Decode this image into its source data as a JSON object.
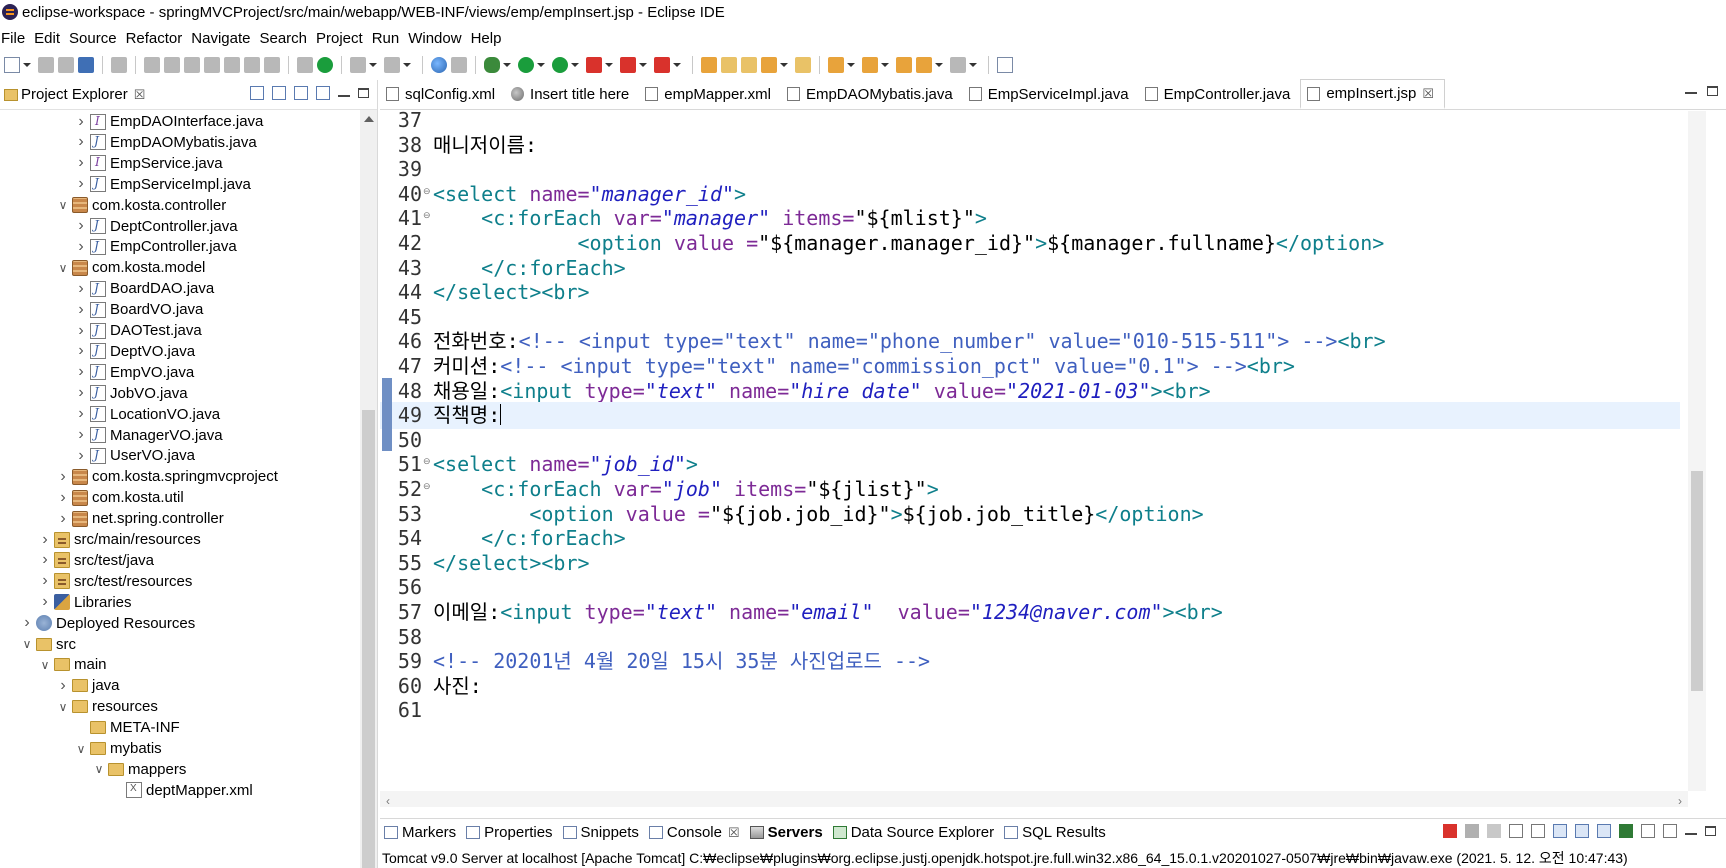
{
  "window": {
    "title": "eclipse-workspace - springMVCProject/src/main/webapp/WEB-INF/views/emp/empInsert.jsp - Eclipse IDE"
  },
  "menu": [
    "File",
    "Edit",
    "Source",
    "Refactor",
    "Navigate",
    "Search",
    "Project",
    "Run",
    "Window",
    "Help"
  ],
  "project_explorer": {
    "title": "Project Explorer",
    "close": "☒",
    "items": [
      {
        "label": "EmpDAOInterface.java",
        "icon": "interface-icon",
        "indent": 4,
        "twisty": "closed"
      },
      {
        "label": "EmpDAOMybatis.java",
        "icon": "java-file-icon",
        "indent": 4,
        "twisty": "closed"
      },
      {
        "label": "EmpService.java",
        "icon": "interface-icon",
        "indent": 4,
        "twisty": "closed"
      },
      {
        "label": "EmpServiceImpl.java",
        "icon": "java-file-icon",
        "indent": 4,
        "twisty": "closed"
      },
      {
        "label": "com.kosta.controller",
        "icon": "package-icon",
        "indent": 3,
        "twisty": "open"
      },
      {
        "label": "DeptController.java",
        "icon": "java-file-icon",
        "indent": 4,
        "twisty": "closed"
      },
      {
        "label": "EmpController.java",
        "icon": "java-file-icon",
        "indent": 4,
        "twisty": "closed"
      },
      {
        "label": "com.kosta.model",
        "icon": "package-icon",
        "indent": 3,
        "twisty": "open"
      },
      {
        "label": "BoardDAO.java",
        "icon": "java-file-icon",
        "indent": 4,
        "twisty": "closed"
      },
      {
        "label": "BoardVO.java",
        "icon": "java-file-icon",
        "indent": 4,
        "twisty": "closed"
      },
      {
        "label": "DAOTest.java",
        "icon": "java-file-icon",
        "indent": 4,
        "twisty": "closed"
      },
      {
        "label": "DeptVO.java",
        "icon": "java-file-icon",
        "indent": 4,
        "twisty": "closed"
      },
      {
        "label": "EmpVO.java",
        "icon": "java-file-icon",
        "indent": 4,
        "twisty": "closed"
      },
      {
        "label": "JobVO.java",
        "icon": "java-file-icon",
        "indent": 4,
        "twisty": "closed"
      },
      {
        "label": "LocationVO.java",
        "icon": "java-file-icon",
        "indent": 4,
        "twisty": "closed"
      },
      {
        "label": "ManagerVO.java",
        "icon": "java-file-icon",
        "indent": 4,
        "twisty": "closed"
      },
      {
        "label": "UserVO.java",
        "icon": "java-file-icon",
        "indent": 4,
        "twisty": "closed"
      },
      {
        "label": "com.kosta.springmvcproject",
        "icon": "package-icon",
        "indent": 3,
        "twisty": "closed"
      },
      {
        "label": "com.kosta.util",
        "icon": "package-icon",
        "indent": 3,
        "twisty": "closed"
      },
      {
        "label": "net.spring.controller",
        "icon": "package-icon",
        "indent": 3,
        "twisty": "closed"
      },
      {
        "label": "src/main/resources",
        "icon": "source-folder-icon",
        "indent": 2,
        "twisty": "closed"
      },
      {
        "label": "src/test/java",
        "icon": "source-folder-icon",
        "indent": 2,
        "twisty": "closed"
      },
      {
        "label": "src/test/resources",
        "icon": "source-folder-icon",
        "indent": 2,
        "twisty": "closed"
      },
      {
        "label": "Libraries",
        "icon": "libraries-icon",
        "indent": 2,
        "twisty": "closed"
      },
      {
        "label": "Deployed Resources",
        "icon": "deployed-resources-icon",
        "indent": 1,
        "twisty": "closed"
      },
      {
        "label": "src",
        "icon": "folder-icon",
        "indent": 1,
        "twisty": "open"
      },
      {
        "label": "main",
        "icon": "folder-icon",
        "indent": 2,
        "twisty": "open"
      },
      {
        "label": "java",
        "icon": "folder-icon",
        "indent": 3,
        "twisty": "closed"
      },
      {
        "label": "resources",
        "icon": "folder-icon",
        "indent": 3,
        "twisty": "open"
      },
      {
        "label": "META-INF",
        "icon": "folder-icon",
        "indent": 4,
        "twisty": "none"
      },
      {
        "label": "mybatis",
        "icon": "folder-icon",
        "indent": 4,
        "twisty": "open"
      },
      {
        "label": "mappers",
        "icon": "folder-icon",
        "indent": 5,
        "twisty": "open"
      },
      {
        "label": "deptMapper.xml",
        "icon": "xml-file-icon",
        "indent": 6,
        "twisty": "none"
      }
    ]
  },
  "editor_tabs": [
    {
      "label": "sqlConfig.xml",
      "icon": "xml-file-icon",
      "active": false
    },
    {
      "label": "Insert title here",
      "icon": "browser-icon",
      "active": false
    },
    {
      "label": "empMapper.xml",
      "icon": "xml-file-icon",
      "active": false
    },
    {
      "label": "EmpDAOMybatis.java",
      "icon": "java-file-icon",
      "active": false
    },
    {
      "label": "EmpServiceImpl.java",
      "icon": "java-file-icon",
      "active": false
    },
    {
      "label": "EmpController.java",
      "icon": "java-file-icon",
      "active": false
    },
    {
      "label": "empInsert.jsp",
      "icon": "jsp-file-icon",
      "active": true,
      "close": "☒"
    }
  ],
  "code_lines": [
    {
      "n": "37",
      "fold": "",
      "parts": []
    },
    {
      "n": "38",
      "fold": "",
      "parts": [
        {
          "t": "매니저이름:",
          "c": "c-el"
        }
      ]
    },
    {
      "n": "39",
      "fold": "",
      "parts": []
    },
    {
      "n": "40",
      "fold": "⊖",
      "parts": [
        {
          "t": "<select ",
          "c": "c-tag"
        },
        {
          "t": "name=",
          "c": "c-attr"
        },
        {
          "t": "\"manager_id\"",
          "c": "c-str"
        },
        {
          "t": ">",
          "c": "c-tag"
        }
      ]
    },
    {
      "n": "41",
      "fold": "⊖",
      "parts": [
        {
          "t": "    <c:forEach ",
          "c": "c-tag"
        },
        {
          "t": "var=",
          "c": "c-attr"
        },
        {
          "t": "\"manager\"",
          "c": "c-str"
        },
        {
          "t": " items=",
          "c": "c-attr"
        },
        {
          "t": "\"${mlist}\"",
          "c": "c-plain-str"
        },
        {
          "t": ">",
          "c": "c-tag"
        }
      ]
    },
    {
      "n": "42",
      "fold": "",
      "parts": [
        {
          "t": "            <option ",
          "c": "c-tag"
        },
        {
          "t": "value =",
          "c": "c-attr"
        },
        {
          "t": "\"${manager.manager_id}\"",
          "c": "c-plain-str"
        },
        {
          "t": ">",
          "c": "c-tag"
        },
        {
          "t": "${manager.fullname}",
          "c": "c-el"
        },
        {
          "t": "</option>",
          "c": "c-tag"
        }
      ]
    },
    {
      "n": "43",
      "fold": "",
      "parts": [
        {
          "t": "    </c:forEach>",
          "c": "c-tag"
        }
      ]
    },
    {
      "n": "44",
      "fold": "",
      "parts": [
        {
          "t": "</select><br>",
          "c": "c-tag"
        }
      ]
    },
    {
      "n": "45",
      "fold": "",
      "parts": []
    },
    {
      "n": "46",
      "fold": "",
      "parts": [
        {
          "t": "전화번호:",
          "c": "c-el"
        },
        {
          "t": "<!-- <input type=\"text\" name=\"phone_number\" value=\"010-515-511\"> -->",
          "c": "c-comment"
        },
        {
          "t": "<br>",
          "c": "c-tag"
        }
      ]
    },
    {
      "n": "47",
      "fold": "",
      "parts": [
        {
          "t": "커미션:",
          "c": "c-el"
        },
        {
          "t": "<!-- <input type=\"text\" name=\"commission_pct\" value=\"0.1\"> -->",
          "c": "c-comment"
        },
        {
          "t": "<br>",
          "c": "c-tag"
        }
      ]
    },
    {
      "n": "48",
      "fold": "",
      "parts": [
        {
          "t": "채용일:",
          "c": "c-el"
        },
        {
          "t": "<input ",
          "c": "c-tag"
        },
        {
          "t": "type=",
          "c": "c-attr"
        },
        {
          "t": "\"text\"",
          "c": "c-str"
        },
        {
          "t": " name=",
          "c": "c-attr"
        },
        {
          "t": "\"hire_date\"",
          "c": "c-str"
        },
        {
          "t": " value=",
          "c": "c-attr"
        },
        {
          "t": "\"2021-01-03\"",
          "c": "c-str"
        },
        {
          "t": "><br>",
          "c": "c-tag"
        }
      ]
    },
    {
      "n": "49",
      "fold": "",
      "current": true,
      "parts": [
        {
          "t": "직책명:",
          "c": "c-el"
        }
      ]
    },
    {
      "n": "50",
      "fold": "",
      "parts": []
    },
    {
      "n": "51",
      "fold": "⊖",
      "parts": [
        {
          "t": "<select ",
          "c": "c-tag"
        },
        {
          "t": "name=",
          "c": "c-attr"
        },
        {
          "t": "\"job_id\"",
          "c": "c-str"
        },
        {
          "t": ">",
          "c": "c-tag"
        }
      ]
    },
    {
      "n": "52",
      "fold": "⊖",
      "parts": [
        {
          "t": "    <c:forEach ",
          "c": "c-tag"
        },
        {
          "t": "var=",
          "c": "c-attr"
        },
        {
          "t": "\"job\"",
          "c": "c-str"
        },
        {
          "t": " items=",
          "c": "c-attr"
        },
        {
          "t": "\"${jlist}\"",
          "c": "c-plain-str"
        },
        {
          "t": ">",
          "c": "c-tag"
        }
      ]
    },
    {
      "n": "53",
      "fold": "",
      "parts": [
        {
          "t": "        <option ",
          "c": "c-tag"
        },
        {
          "t": "value =",
          "c": "c-attr"
        },
        {
          "t": "\"${job.job_id}\"",
          "c": "c-plain-str"
        },
        {
          "t": ">",
          "c": "c-tag"
        },
        {
          "t": "${job.job_title}",
          "c": "c-el"
        },
        {
          "t": "</option>",
          "c": "c-tag"
        }
      ]
    },
    {
      "n": "54",
      "fold": "",
      "parts": [
        {
          "t": "    </c:forEach>",
          "c": "c-tag"
        }
      ]
    },
    {
      "n": "55",
      "fold": "",
      "parts": [
        {
          "t": "</select><br>",
          "c": "c-tag"
        }
      ]
    },
    {
      "n": "56",
      "fold": "",
      "parts": []
    },
    {
      "n": "57",
      "fold": "",
      "parts": [
        {
          "t": "이메일:",
          "c": "c-el"
        },
        {
          "t": "<input ",
          "c": "c-tag"
        },
        {
          "t": "type=",
          "c": "c-attr"
        },
        {
          "t": "\"text\"",
          "c": "c-str"
        },
        {
          "t": " name=",
          "c": "c-attr"
        },
        {
          "t": "\"email\"",
          "c": "c-str"
        },
        {
          "t": "  value=",
          "c": "c-attr"
        },
        {
          "t": "\"1234@naver.com\"",
          "c": "c-str"
        },
        {
          "t": "><br>",
          "c": "c-tag"
        }
      ]
    },
    {
      "n": "58",
      "fold": "",
      "parts": []
    },
    {
      "n": "59",
      "fold": "",
      "parts": [
        {
          "t": "<!-- 20201년 4월 20일 15시 35분 사진업로드 -->",
          "c": "c-comment"
        }
      ]
    },
    {
      "n": "60",
      "fold": "",
      "parts": [
        {
          "t": "사진:",
          "c": "c-el"
        }
      ]
    },
    {
      "n": "61",
      "fold": "",
      "parts": []
    }
  ],
  "bottom_tabs": [
    {
      "label": "Markers",
      "icon": "markers-icon",
      "active": false
    },
    {
      "label": "Properties",
      "icon": "properties-icon",
      "active": false
    },
    {
      "label": "Snippets",
      "icon": "snippets-icon",
      "active": false
    },
    {
      "label": "Console",
      "icon": "console-icon",
      "active": false,
      "close": "☒"
    },
    {
      "label": "Servers",
      "icon": "servers-icon",
      "active": true
    },
    {
      "label": "Data Source Explorer",
      "icon": "data-source-icon",
      "active": false
    },
    {
      "label": "SQL Results",
      "icon": "sql-results-icon",
      "active": false
    }
  ],
  "console_status": "Tomcat v9.0 Server at localhost [Apache Tomcat] C:₩eclipse₩plugins₩org.eclipse.justj.openjdk.hotspot.jre.full.win32.x86_64_15.0.1.v20201027-0507₩jre₩bin₩javaw.exe  (2021. 5. 12. 오전 10:47:43)"
}
